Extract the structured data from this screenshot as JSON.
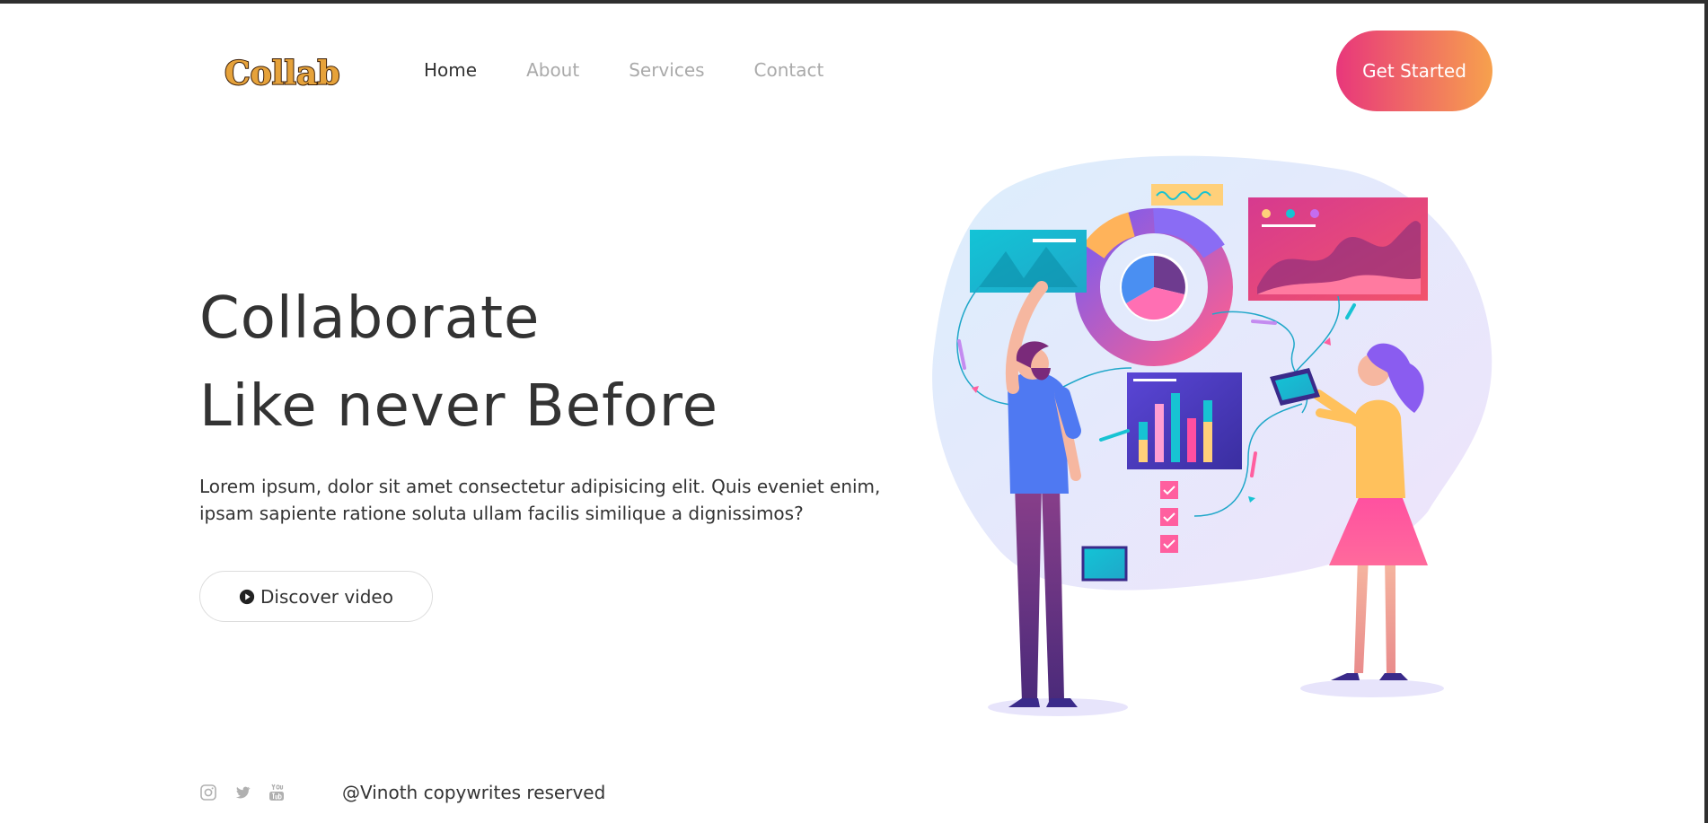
{
  "brand": {
    "logo_text": "Collab"
  },
  "nav": {
    "items": [
      {
        "label": "Home",
        "active": true
      },
      {
        "label": "About",
        "active": false
      },
      {
        "label": "Services",
        "active": false
      },
      {
        "label": "Contact",
        "active": false
      }
    ]
  },
  "cta": {
    "label": "Get Started",
    "gradient_start": "#e8377b",
    "gradient_end": "#f7a14d"
  },
  "hero": {
    "title_line1": "Collaborate",
    "title_line2": "Like never Before",
    "text": "Lorem ipsum, dolor sit amet consectetur adipisicing elit. Quis eveniet enim, ipsam sapiente ratione soluta ullam facilis similique a dignissimos?",
    "video_button_label": "Discover video",
    "video_icon": "play-circle-icon"
  },
  "illustration": {
    "subject": "team-analytics-illustration"
  },
  "footer": {
    "social_icons": [
      "instagram-icon",
      "twitter-icon",
      "youtube-icon"
    ],
    "copyright": "@Vinoth copywrites reserved"
  },
  "colors": {
    "text_dark": "#333333",
    "nav_inactive": "#aaaaaa",
    "accent_pink": "#e8377b",
    "accent_orange": "#f7a14d",
    "accent_teal": "#17c3d3",
    "accent_purple": "#7a5cf0"
  }
}
